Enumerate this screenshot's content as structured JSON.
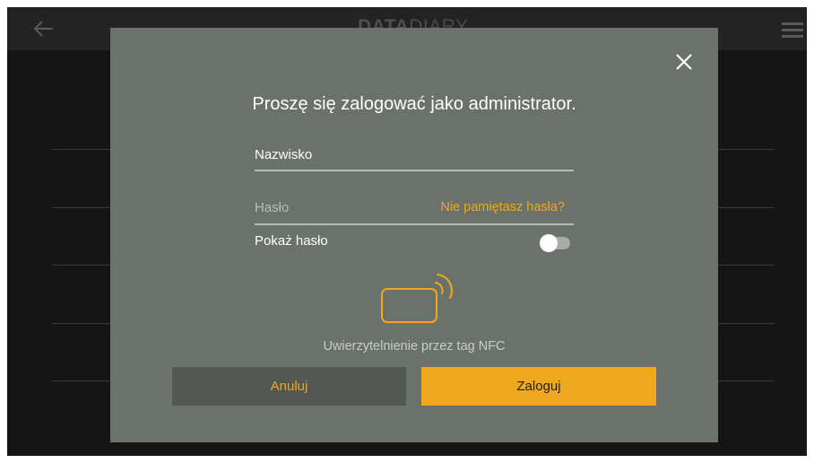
{
  "app": {
    "logo_bold": "DATA",
    "logo_light": "DIARY"
  },
  "login_dialog": {
    "title": "Proszę się zalogować jako administrator.",
    "username_placeholder": "Nazwisko",
    "password_placeholder": "Hasło",
    "forgot_password_link": "Nie pamiętasz hasła?",
    "show_password_label": "Pokaż hasło",
    "show_password_enabled": false,
    "nfc_label": "Uwierzytelnienie przez tag NFC",
    "cancel_button": "Anuluj",
    "login_button": "Zaloguj"
  },
  "colors": {
    "accent": "#f0a81e",
    "dialog_background": "#6b716b",
    "cancel_button_background": "#525752",
    "app_background": "#151515"
  },
  "icons": {
    "back": "arrow-left-icon",
    "menu": "hamburger-menu-icon",
    "close": "close-icon",
    "nfc": "nfc-card-icon"
  }
}
